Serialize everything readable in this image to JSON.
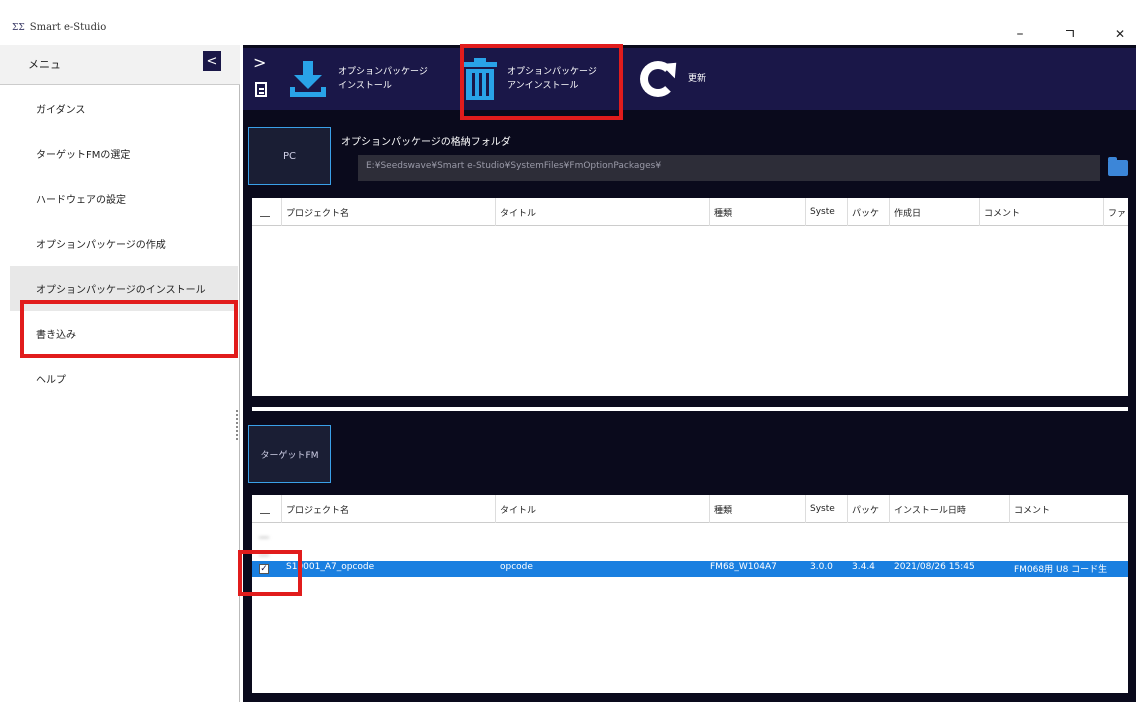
{
  "window": {
    "title": "Smart e-Studio",
    "logo": "ΣΣ",
    "minimize": "–",
    "maximize": "ㄱ",
    "close": "✕"
  },
  "sidebar": {
    "title": "メニュ",
    "collapse": "<",
    "items": [
      {
        "label": "ガイダンス"
      },
      {
        "label": "ターゲットFMの選定"
      },
      {
        "label": "ハードウェアの設定"
      },
      {
        "label": "オプションパッケージの作成"
      },
      {
        "label": "オプションパッケージのインストール",
        "selected": true
      },
      {
        "label": "書き込み"
      },
      {
        "label": "ヘルプ"
      }
    ]
  },
  "toolbar": {
    "toggle": ">",
    "install_label_1": "オプションパッケージ",
    "install_label_2": "インストール",
    "uninstall_label_1": "オプションパッケージ",
    "uninstall_label_2": "アンインストール",
    "refresh_label": "更新"
  },
  "pc": {
    "tab_label": "PC",
    "folder_label": "オプションパッケージの格納フォルダ",
    "folder_path": "E:¥Seedswave¥Smart e-Studio¥SystemFiles¥FmOptionPackages¥"
  },
  "columns_pc": [
    "プロジェクト名",
    "タイトル",
    "種類",
    "Syste",
    "パッケ",
    "作成日",
    "コメント",
    "ファ"
  ],
  "target": {
    "tab_label": "ターゲットFM"
  },
  "columns_target": [
    "プロジェクト名",
    "タイトル",
    "種類",
    "Syste",
    "パッケ",
    "インストール日時",
    "コメント"
  ],
  "target_rows": [
    {
      "project": "",
      "title": "",
      "type": "",
      "sys": "",
      "pkg": "",
      "date": "",
      "comment": "",
      "checked": false,
      "blurred": true
    },
    {
      "project": "",
      "title": "",
      "type": "",
      "sys": "",
      "pkg": "",
      "date": "",
      "comment": "",
      "checked": false,
      "blurred": true
    },
    {
      "project": "S10001_A7_opcode",
      "title": "opcode",
      "type": "FM68_W104A7",
      "sys": "3.0.0",
      "pkg": "3.4.4",
      "date": "2021/08/26 15:45",
      "comment": "FM068用 U8 コード生",
      "checked": true,
      "selected": true
    }
  ],
  "colors": {
    "toolbar_bg": "#1a1748",
    "main_bg": "#0a0a1c",
    "accent": "#29a3e8",
    "selection": "#1a7fe0",
    "highlight": "#e11c1c"
  }
}
